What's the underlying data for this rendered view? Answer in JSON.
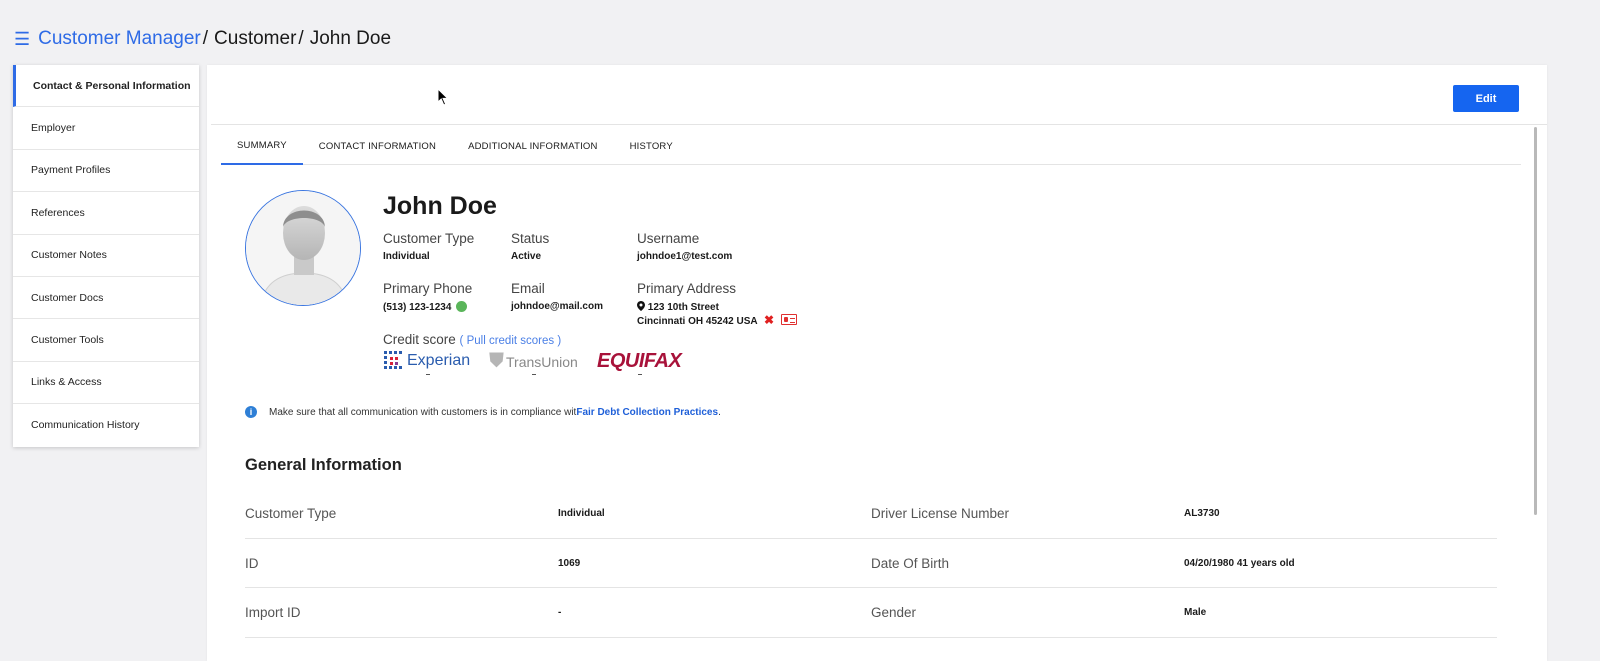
{
  "breadcrumb": {
    "root": "Customer Manager",
    "level2": "Customer",
    "current": "John Doe",
    "separator": "/"
  },
  "sidebar": {
    "items": [
      {
        "label": "Contact & Personal Information"
      },
      {
        "label": "Employer"
      },
      {
        "label": "Payment Profiles"
      },
      {
        "label": "References"
      },
      {
        "label": "Customer Notes"
      },
      {
        "label": "Customer Docs"
      },
      {
        "label": "Customer Tools"
      },
      {
        "label": "Links & Access"
      },
      {
        "label": "Communication History"
      }
    ]
  },
  "toolbar": {
    "edit_label": "Edit"
  },
  "tabs": [
    {
      "label": "SUMMARY"
    },
    {
      "label": "CONTACT INFORMATION"
    },
    {
      "label": "ADDITIONAL INFORMATION"
    },
    {
      "label": "HISTORY"
    }
  ],
  "profile": {
    "name": "John Doe",
    "customer_type": {
      "label": "Customer Type",
      "value": "Individual"
    },
    "status": {
      "label": "Status",
      "value": "Active"
    },
    "username": {
      "label": "Username",
      "value": "johndoe1@test.com"
    },
    "primary_phone": {
      "label": "Primary Phone",
      "value": "(513) 123-1234"
    },
    "email": {
      "label": "Email",
      "value": "johndoe@mail.com"
    },
    "primary_address": {
      "label": "Primary Address",
      "line1": "123 10th Street",
      "line2": "Cincinnati OH 45242 USA"
    },
    "credit": {
      "label": "Credit score",
      "link": "( Pull credit scores )",
      "bureaus": [
        {
          "name": "Experian",
          "score": "-"
        },
        {
          "name": "TransUnion",
          "score": "-"
        },
        {
          "name": "EQUIFAX",
          "score": "-"
        }
      ]
    }
  },
  "notice": {
    "text": "Make sure that all communication with customers is in compliance wit ",
    "link": "Fair Debt Collection Practices",
    "suffix": "."
  },
  "general_info": {
    "title": "General Information",
    "rows": [
      {
        "l1": "Customer Type",
        "v1": "Individual",
        "l2": "Driver License Number",
        "v2": "AL3730"
      },
      {
        "l1": "ID",
        "v1": "1069",
        "l2": "Date Of Birth",
        "v2": "04/20/1980 41 years old"
      },
      {
        "l1": "Import ID",
        "v1": "-",
        "l2": "Gender",
        "v2": "Male"
      }
    ]
  },
  "colors": {
    "accent": "#2e6be6",
    "edit_button": "#1565f0",
    "status_online": "#5ab55a",
    "error": "#e02020",
    "equifax": "#a8123a"
  },
  "icons": [
    "menu-icon",
    "map-pin-icon",
    "close-icon",
    "id-card-icon",
    "info-icon",
    "online-status-icon",
    "cursor-icon"
  ]
}
